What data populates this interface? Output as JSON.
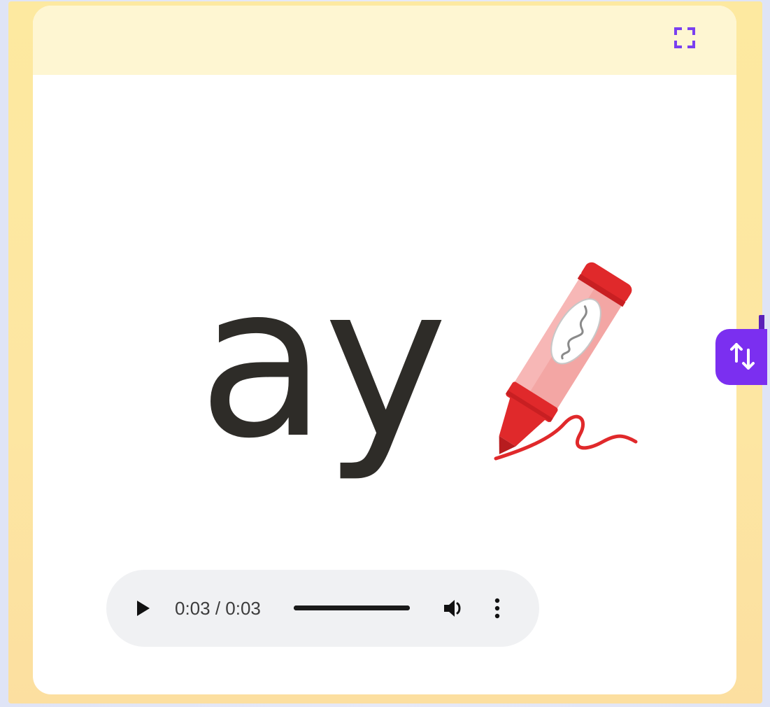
{
  "card": {
    "phoneme": "ay",
    "image_icon": "red-crayon",
    "fullscreen_icon": "fullscreen-corners-icon"
  },
  "audio": {
    "time": "0:03 / 0:03",
    "progress": 1.0,
    "play_icon": "play-icon",
    "volume_icon": "volume-icon",
    "more_icon": "more-vertical-icon"
  },
  "side_tab": {
    "icon": "swap-vertical-icon"
  },
  "colors": {
    "frame": "#fde9a0",
    "header": "#fef6d2",
    "accent_purple": "#7b2ff0",
    "crayon_red": "#e0292b",
    "text_dark": "#2e2c28"
  }
}
